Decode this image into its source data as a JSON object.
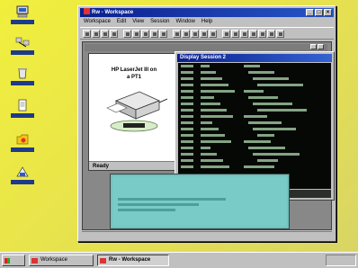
{
  "desktop": {
    "icons": [
      {
        "name": "my-computer-icon"
      },
      {
        "name": "network-neighborhood-icon"
      },
      {
        "name": "recycle-bin-icon"
      },
      {
        "name": "document-icon"
      },
      {
        "name": "folder-icon"
      },
      {
        "name": "application-icon"
      }
    ]
  },
  "window": {
    "title": "Rw - Workspace",
    "menu": [
      "Workspace",
      "Edit",
      "View",
      "Session",
      "Window",
      "Help"
    ]
  },
  "printer": {
    "title_line1": "HP LaserJet III on",
    "title_line2": "a PT1",
    "status": "Ready"
  },
  "terminal": {
    "title": "Display Session 2"
  },
  "taskbar": {
    "tasks": [
      {
        "label": "Workspace",
        "active": false
      },
      {
        "label": "Rw - Workspace",
        "active": true
      }
    ]
  },
  "colors": {
    "desktop": "#f1ef3c",
    "titlebar": "#0a1f8e",
    "terminal_bg": "#050805",
    "session_bg": "#79cbc7"
  }
}
